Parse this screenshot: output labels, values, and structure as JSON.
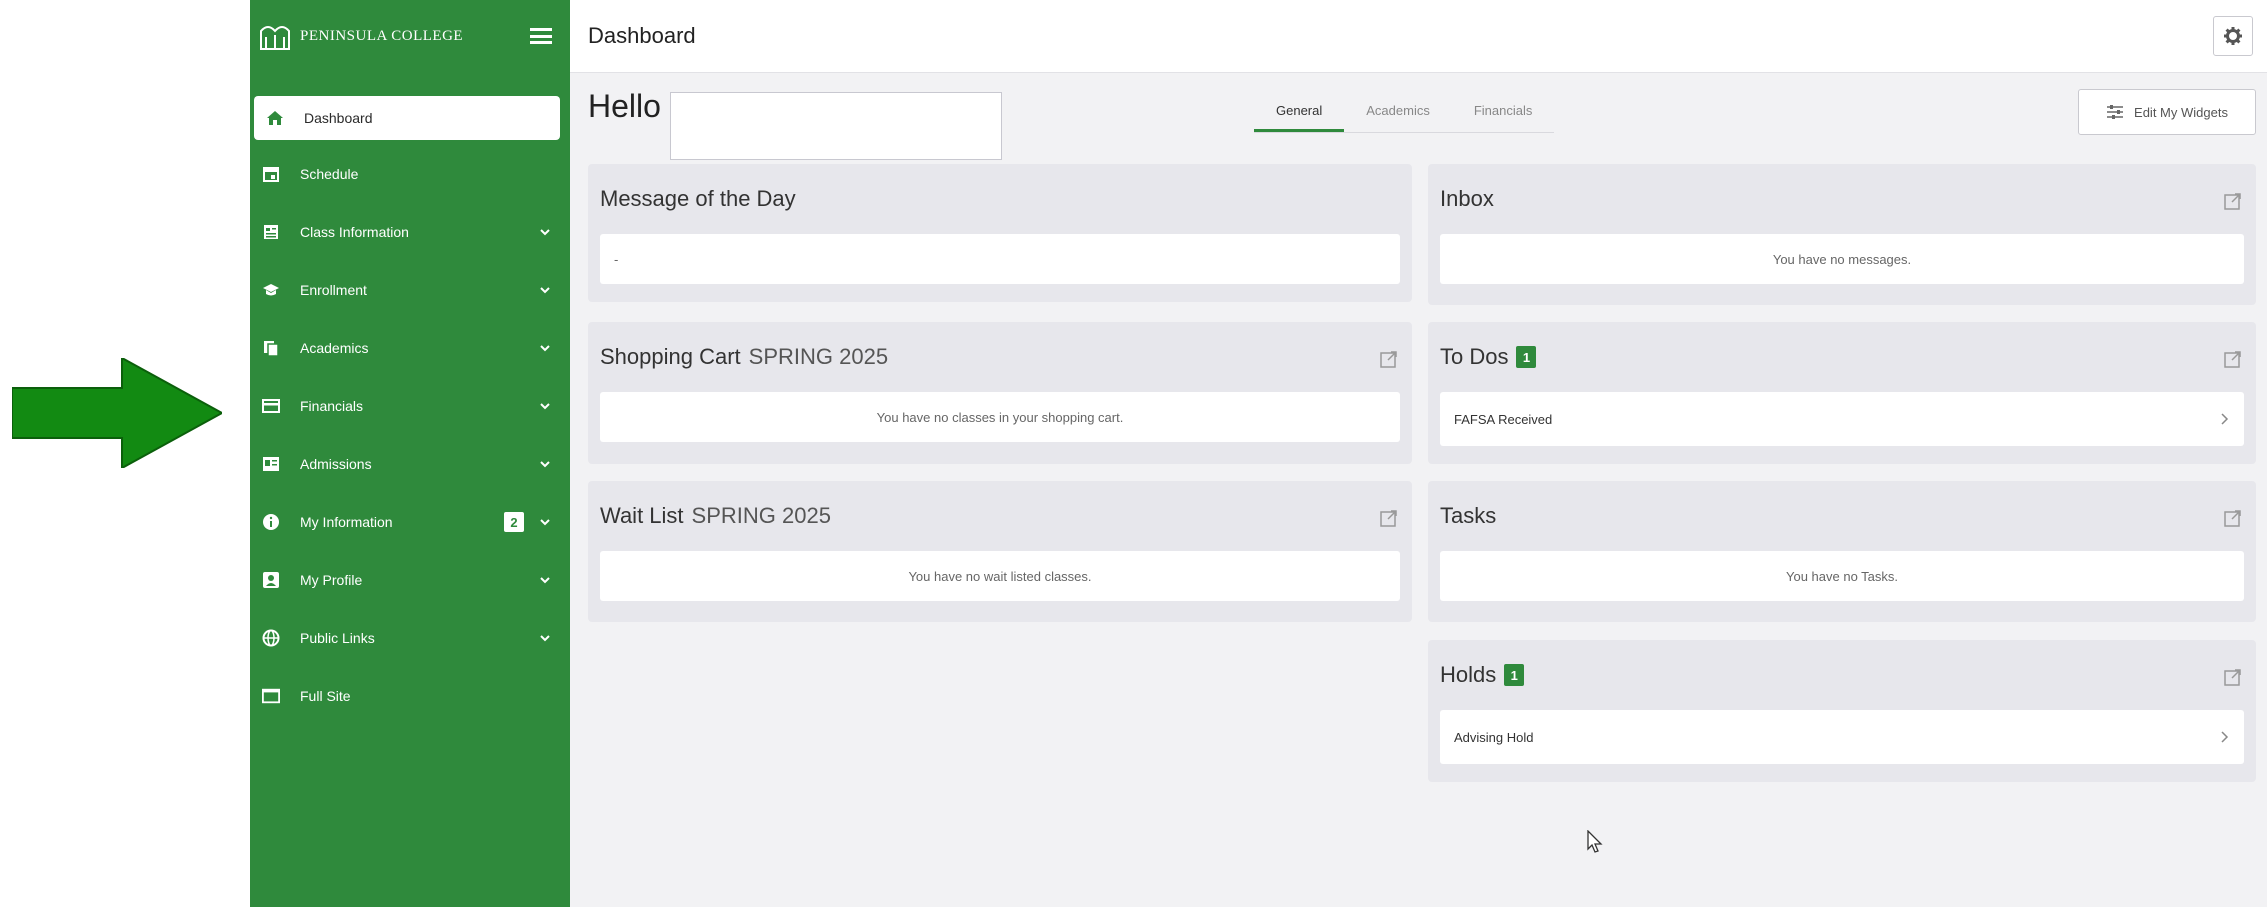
{
  "sidebar": {
    "brand": "PENINSULA COLLEGE",
    "items": [
      {
        "label": "Dashboard",
        "icon": "home-icon"
      },
      {
        "label": "Schedule",
        "icon": "calendar-icon"
      },
      {
        "label": "Class Information",
        "icon": "class-info-icon"
      },
      {
        "label": "Enrollment",
        "icon": "graduation-cap-icon"
      },
      {
        "label": "Academics",
        "icon": "academics-icon"
      },
      {
        "label": "Financials",
        "icon": "credit-card-icon"
      },
      {
        "label": "Admissions",
        "icon": "admissions-icon"
      },
      {
        "label": "My Information",
        "icon": "info-icon",
        "badge": "2"
      },
      {
        "label": "My Profile",
        "icon": "profile-icon"
      },
      {
        "label": "Public Links",
        "icon": "globe-icon"
      },
      {
        "label": "Full Site",
        "icon": "window-icon"
      }
    ]
  },
  "header": {
    "title": "Dashboard"
  },
  "main": {
    "greeting": "Hello",
    "tabs": [
      {
        "label": "General",
        "active": true
      },
      {
        "label": "Academics",
        "active": false
      },
      {
        "label": "Financials",
        "active": false
      }
    ],
    "edit_widgets_label": "Edit My Widgets"
  },
  "widgets": {
    "message_of_day": {
      "title": "Message of the Day",
      "body": "-"
    },
    "shopping_cart": {
      "title": "Shopping Cart",
      "term": "SPRING 2025",
      "body": "You have no classes in your shopping cart."
    },
    "wait_list": {
      "title": "Wait List",
      "term": "SPRING 2025",
      "body": "You have no wait listed classes."
    },
    "inbox": {
      "title": "Inbox",
      "body": "You have no messages."
    },
    "todos": {
      "title": "To Dos",
      "badge": "1",
      "item": "FAFSA Received"
    },
    "tasks": {
      "title": "Tasks",
      "body": "You have no Tasks."
    },
    "holds": {
      "title": "Holds",
      "badge": "1",
      "item": "Advising Hold"
    }
  },
  "colors": {
    "brand_green": "#2f8a3c",
    "arrow_green": "#128a12",
    "page_bg": "#f2f2f4"
  }
}
